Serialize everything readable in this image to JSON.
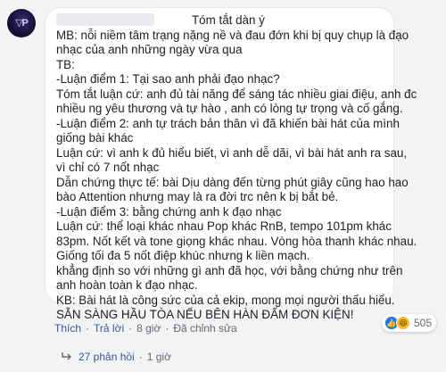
{
  "comment": {
    "lines": [
      "Tóm tắt dàn ý",
      "MB: nỗi niềm tâm trạng nặng nề và đau đớn khi bị quy chụp là đạo",
      "nhạc của anh những ngày vừa qua",
      "TB:",
      "-Luận điểm 1: Tại sao anh phải đạo nhạc?",
      "Tóm tắt luận cứ: anh đủ tài năng để sáng tác nhiều giai điệu, anh đc",
      "nhiều ng yêu thương và tự hào , anh có lòng tự trọng và cố gắng.",
      "-Luận điểm 2: anh tự trách bản thân vì đã khiến bài hát của mình",
      "giống bài khác",
      "Luận cứ: vì anh k đủ hiểu biết, vì anh dễ dãi, vì bài hát anh ra sau,",
      "vì chỉ có 7 nốt nhạc",
      "Dẫn chứng thực tế: bài Dịu dàng đến từng phút giây cũng hao hao",
      "bào Attention nhưng may là ra đời trc nên k bị bắt bẻ.",
      "-Luận điểm 3: bằng chứng anh k đạo nhạc",
      "Luận cứ: thể loại khác nhau Pop khác RnB, tempo 101pm khác",
      "83pm. Nốt kết và tone giọng khác nhau. Vòng hòa thanh khác nhau.",
      "Giống tối đa 5 nốt điệp khúc nhưng k liền mạch.",
      "khẳng định so với những gì anh đã học, với bằng chứng như trên",
      "anh hoàn toàn k đạo nhạc.",
      "KB: Bài hát là công sức của cả ekip, mong mọi người thấu hiểu.",
      "SẴN SÀNG HẦU TÒA NẾU BÊN HÀN ĐẤM ĐƠN KIỆN!"
    ]
  },
  "reactions": {
    "count": "505",
    "like_glyph": "👍",
    "haha_glyph": "😆"
  },
  "actions": {
    "like": "Thích",
    "reply": "Trả lời",
    "time": "8 giờ",
    "edited": "Đã chỉnh sửa",
    "dot": "·"
  },
  "replies": {
    "label": "27 phản hồi",
    "time": "1 giờ",
    "dot": "·"
  },
  "colors": {
    "background": "#f2f3f5",
    "link": "#385898",
    "muted": "#65676b",
    "like": "#1877f2"
  }
}
